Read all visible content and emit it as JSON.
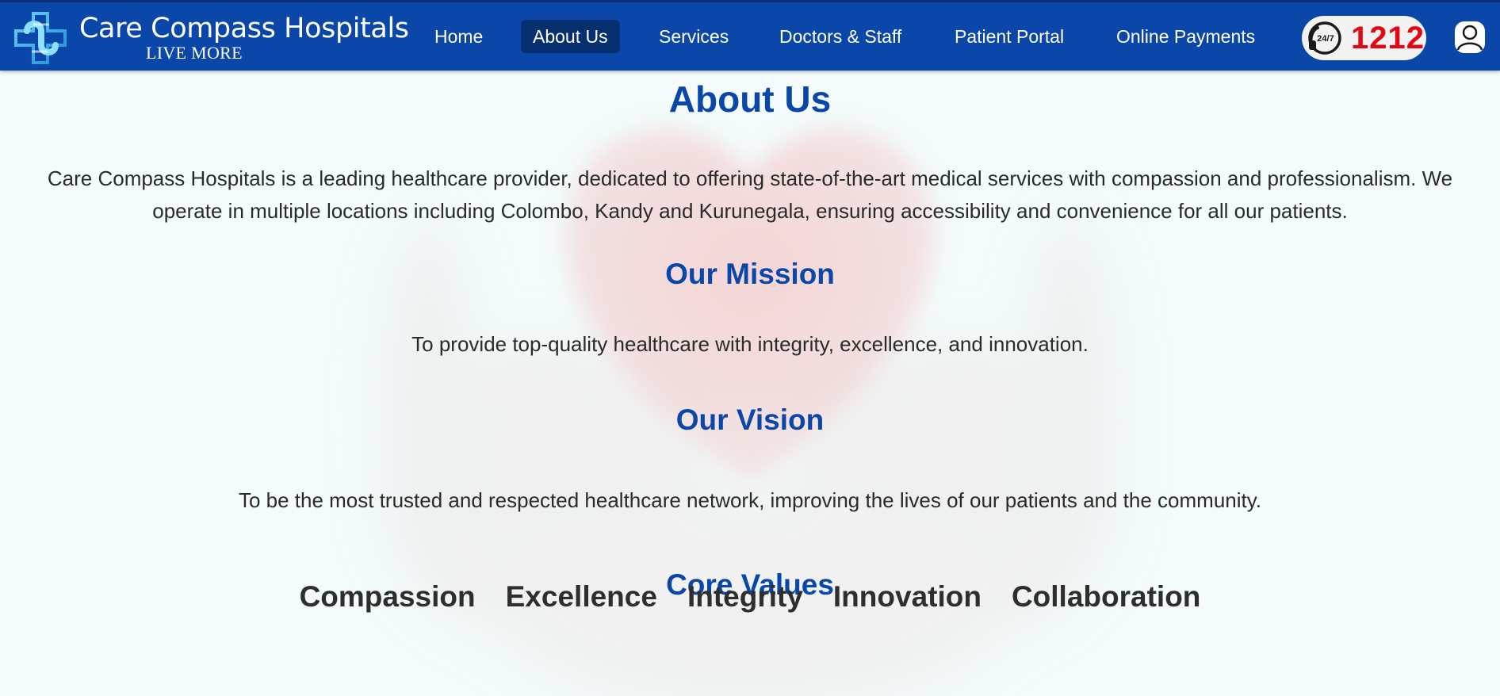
{
  "header": {
    "brand_name": "Care Compass Hospitals",
    "brand_tagline": "LIVE MORE",
    "hotline_badge": "24/7",
    "hotline_number": "1212",
    "nav": [
      {
        "label": "Home"
      },
      {
        "label": "About Us",
        "active": true
      },
      {
        "label": "Services"
      },
      {
        "label": "Doctors & Staff"
      },
      {
        "label": "Patient Portal"
      },
      {
        "label": "Online Payments"
      }
    ]
  },
  "colors": {
    "primary": "#0a47a8",
    "active_nav": "#052f6f",
    "hotline_red": "#e30613"
  },
  "about": {
    "title": "About Us",
    "intro": "Care Compass Hospitals is a leading healthcare provider, dedicated to offering state-of-the-art medical services with compassion and professionalism. We operate in multiple locations including Colombo, Kandy and Kurunegala, ensuring accessibility and convenience for all our patients.",
    "mission_heading": "Our Mission",
    "mission_text": "To provide top-quality healthcare with integrity, excellence, and innovation.",
    "vision_heading": "Our Vision",
    "vision_text": "To be the most trusted and respected healthcare network, improving the lives of our patients and the community.",
    "values_heading": "Core Values",
    "values": [
      "Compassion",
      "Excellence",
      "Integrity",
      "Innovation",
      "Collaboration"
    ]
  },
  "icons": {
    "logo": "medical-cross-logo-icon",
    "hotline": "phone-24-7-icon",
    "profile": "user-profile-icon"
  }
}
